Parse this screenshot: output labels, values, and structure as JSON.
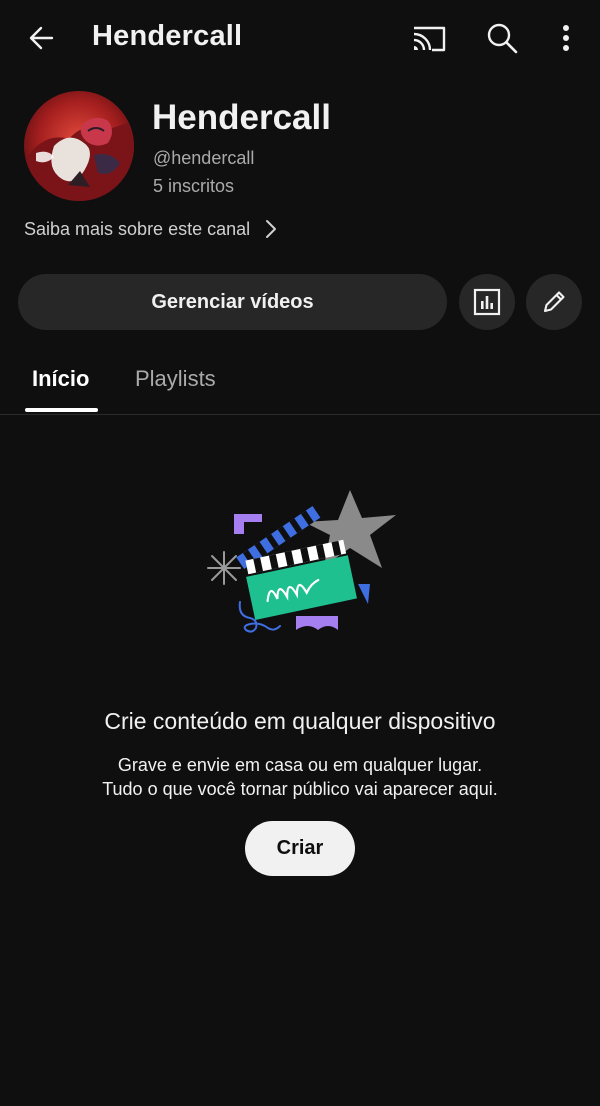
{
  "topbar": {
    "title": "Hendercall",
    "icons": [
      "back-arrow-icon",
      "cast-icon",
      "search-icon",
      "more-vert-icon"
    ]
  },
  "channel": {
    "name": "Hendercall",
    "handle": "@hendercall",
    "subscribers": "5 inscritos",
    "about_link": "Saiba mais sobre este canal"
  },
  "actions": {
    "manage_label": "Gerenciar vídeos",
    "icons": [
      "analytics-icon",
      "edit-pencil-icon"
    ]
  },
  "tabs": [
    {
      "label": "Início",
      "selected": true
    },
    {
      "label": "Playlists",
      "selected": false
    }
  ],
  "empty_state": {
    "title": "Crie conteúdo em qualquer dispositivo",
    "line1": "Grave e envie em casa ou em qualquer lugar.",
    "line2": "Tudo o que você tornar público vai aparecer aqui.",
    "button_label": "Criar"
  },
  "colors": {
    "background": "#0f0f0f",
    "surface": "#272727",
    "text": "#f1f1f1",
    "secondary_text": "#aaaaaa",
    "clapper_teal": "#1fc08f",
    "accent_blue": "#3e6ee0",
    "accent_purple": "#a57ef0"
  }
}
